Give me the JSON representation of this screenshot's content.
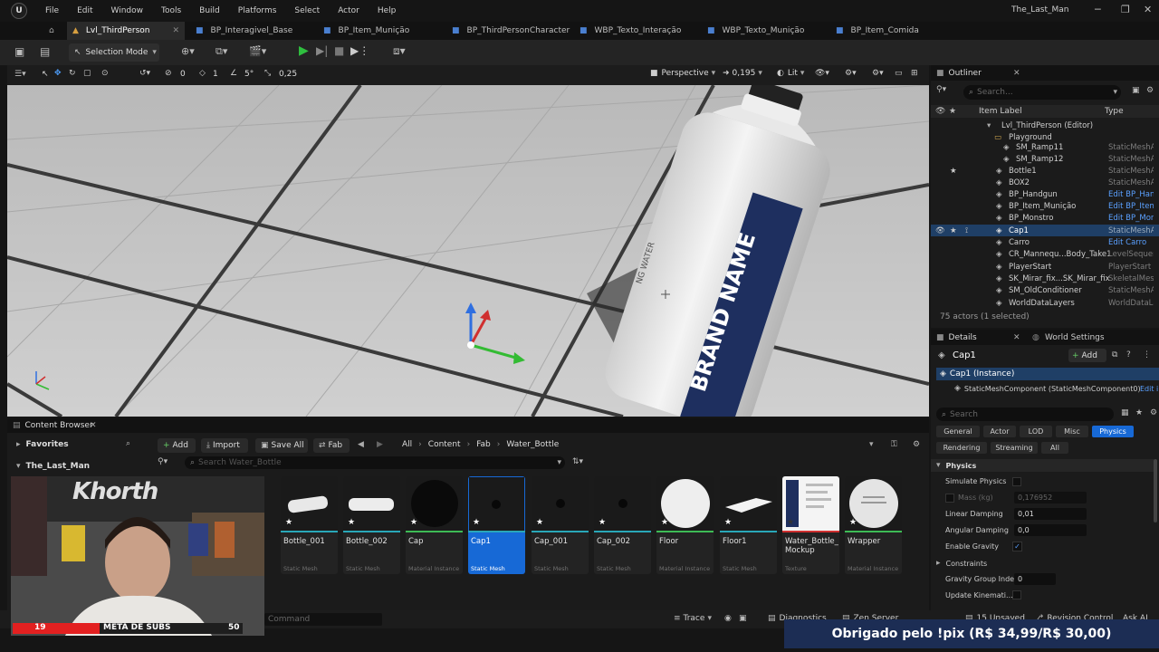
{
  "menu": [
    "File",
    "Edit",
    "Window",
    "Tools",
    "Build",
    "Platforms",
    "Select",
    "Actor",
    "Help"
  ],
  "project_title": "The_Last_Man",
  "tabs": [
    "Lvl_ThirdPerson",
    "BP_Interagivel_Base",
    "BP_Item_Munição",
    "BP_ThirdPersonCharacter",
    "WBP_Texto_Interação",
    "WBP_Texto_Munição",
    "BP_Item_Comida"
  ],
  "toolbar": {
    "selection_mode": "Selection Mode"
  },
  "viewport_toolbar": {
    "grid": "0",
    "rot": "1",
    "angle": "5°",
    "scale": "0,25",
    "view": "Perspective",
    "speed": "0,195",
    "lit": "Lit"
  },
  "bottle": {
    "text1": "BRAND NAME",
    "text2": "NG WATER"
  },
  "outliner": {
    "title": "Outliner",
    "search_placeholder": "Search...",
    "col_label": "Item Label",
    "col_type": "Type",
    "rows": [
      {
        "label": "Lvl_ThirdPerson (Editor)",
        "type": "",
        "indent": 0
      },
      {
        "label": "Playground",
        "type": "",
        "indent": 1
      },
      {
        "label": "SM_Ramp11",
        "type": "StaticMeshActor",
        "indent": 2
      },
      {
        "label": "SM_Ramp12",
        "type": "StaticMeshActor",
        "indent": 2
      },
      {
        "label": "Bottle1",
        "type": "StaticMeshActor",
        "indent": 1
      },
      {
        "label": "BOX2",
        "type": "StaticMeshActor",
        "indent": 1
      },
      {
        "label": "BP_Handgun",
        "type": "Edit BP_Handgun",
        "indent": 1
      },
      {
        "label": "BP_Item_Munição",
        "type": "Edit BP_Item_Munição",
        "indent": 1
      },
      {
        "label": "BP_Monstro",
        "type": "Edit BP_Monstro",
        "indent": 1
      },
      {
        "label": "Cap1",
        "type": "StaticMeshActor",
        "indent": 1
      },
      {
        "label": "Carro",
        "type": "Edit Carro",
        "indent": 1
      },
      {
        "label": "CR_Mannequ...Body_Take1",
        "type": "LevelSequenceActor",
        "indent": 1
      },
      {
        "label": "PlayerStart",
        "type": "PlayerStart",
        "indent": 1
      },
      {
        "label": "SK_Mirar_fix...SK_Mirar_fix",
        "type": "SkeletalMeshActor",
        "indent": 1
      },
      {
        "label": "SM_OldConditioner",
        "type": "StaticMeshActor",
        "indent": 1
      },
      {
        "label": "WorldDataLayers",
        "type": "WorldDataLayers",
        "indent": 1
      }
    ],
    "footer": "75 actors (1 selected)"
  },
  "details": {
    "tab1": "Details",
    "tab2": "World Settings",
    "actor": "Cap1",
    "add": "Add",
    "instance": "Cap1 (Instance)",
    "component": "StaticMeshComponent (StaticMeshComponent0)",
    "edit": "Edit i",
    "search_placeholder": "Search",
    "filters1": [
      "General",
      "Actor",
      "LOD",
      "Misc",
      "Physics"
    ],
    "filters2": [
      "Rendering",
      "Streaming",
      "All"
    ],
    "section": "Physics",
    "props": [
      {
        "label": "Simulate Physics",
        "value": ""
      },
      {
        "label": "Mass (kg)",
        "value": "0,176952"
      },
      {
        "label": "Linear Damping",
        "value": "0,01"
      },
      {
        "label": "Angular Damping",
        "value": "0,0"
      },
      {
        "label": "Enable Gravity",
        "value": "✓"
      },
      {
        "label": "Constraints",
        "value": ""
      },
      {
        "label": "Gravity Group Index",
        "value": "0"
      },
      {
        "label": "Update Kinemati...",
        "value": ""
      }
    ]
  },
  "content_browser": {
    "title": "Content Browser",
    "add": "Add",
    "import": "Import",
    "save_all": "Save All",
    "fab": "Fab",
    "path": [
      "All",
      "Content",
      "Fab",
      "Water_Bottle"
    ],
    "favorites": "Favorites",
    "root": "The_Last_Man",
    "search_placeholder": "Search Water_Bottle",
    "assets": [
      {
        "name": "Bottle_001",
        "type": "Static Mesh"
      },
      {
        "name": "Bottle_002",
        "type": "Static Mesh"
      },
      {
        "name": "Cap",
        "type": "Material Instance"
      },
      {
        "name": "Cap1",
        "type": "Static Mesh"
      },
      {
        "name": "Cap_001",
        "type": "Static Mesh"
      },
      {
        "name": "Cap_002",
        "type": "Static Mesh"
      },
      {
        "name": "Floor",
        "type": "Material Instance"
      },
      {
        "name": "Floor1",
        "type": "Static Mesh"
      },
      {
        "name": "Water_Bottle_\nMockup",
        "type": "Texture"
      },
      {
        "name": "Wrapper",
        "type": "Material Instance"
      }
    ]
  },
  "statusbar": {
    "cmd": "Command",
    "trace": "Trace",
    "diag": "Diagnostics",
    "zen": "Zen Server",
    "unsaved": "15 Unsaved",
    "rev": "Revision Control",
    "ask": "Ask AI"
  },
  "overlay": {
    "webcam_sign": "Khorth",
    "sub_current": "19",
    "sub_label": "META DE SUBS",
    "sub_goal": "50",
    "pix_text": "Obrigado pelo !pix (R$ 34,99/R$ 30,00)"
  },
  "colors": {
    "accent": "#1769d6",
    "selected_row": "#1f3f66",
    "pix_bg": "#1c2d54",
    "play": "#2fbf3f"
  }
}
